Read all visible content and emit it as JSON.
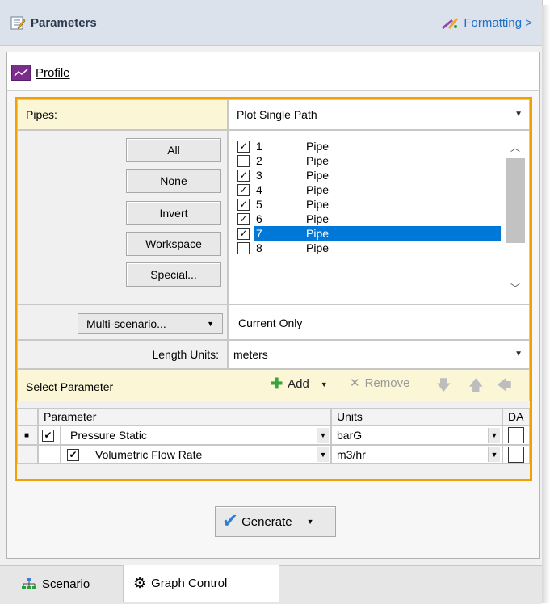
{
  "header": {
    "title": "Parameters",
    "formatting_link": "Formatting >"
  },
  "tabs": {
    "profile": "Profile"
  },
  "pipes": {
    "label": "Pipes:",
    "mode_value": "Plot Single Path",
    "buttons": {
      "all": "All",
      "none": "None",
      "invert": "Invert",
      "workspace": "Workspace",
      "special": "Special..."
    },
    "items": [
      {
        "num": "1",
        "name": "Pipe",
        "checked": true,
        "selected": false
      },
      {
        "num": "2",
        "name": "Pipe",
        "checked": false,
        "selected": false
      },
      {
        "num": "3",
        "name": "Pipe",
        "checked": true,
        "selected": false
      },
      {
        "num": "4",
        "name": "Pipe",
        "checked": true,
        "selected": false
      },
      {
        "num": "5",
        "name": "Pipe",
        "checked": true,
        "selected": false
      },
      {
        "num": "6",
        "name": "Pipe",
        "checked": true,
        "selected": false
      },
      {
        "num": "7",
        "name": "Pipe",
        "checked": true,
        "selected": true
      },
      {
        "num": "8",
        "name": "Pipe",
        "checked": false,
        "selected": false
      }
    ]
  },
  "scenario": {
    "button": "Multi-scenario...",
    "value": "Current Only"
  },
  "length_units": {
    "label": "Length Units:",
    "value": "meters"
  },
  "select_parameter": {
    "label": "Select Parameter",
    "add": "Add",
    "remove": "Remove",
    "columns": {
      "parameter": "Parameter",
      "units": "Units",
      "da": "DA"
    },
    "rows": [
      {
        "parameter": "Pressure Static",
        "units": "barG"
      },
      {
        "parameter": "Volumetric Flow Rate",
        "units": "m3/hr"
      }
    ]
  },
  "generate": {
    "label": "Generate"
  },
  "bottom_tabs": {
    "scenario": "Scenario",
    "graph_control": "Graph Control"
  },
  "colors": {
    "frame": "#f0a000",
    "selection": "#0078d7",
    "link": "#1e6fc7",
    "profile_icon": "#7b2d8e"
  }
}
